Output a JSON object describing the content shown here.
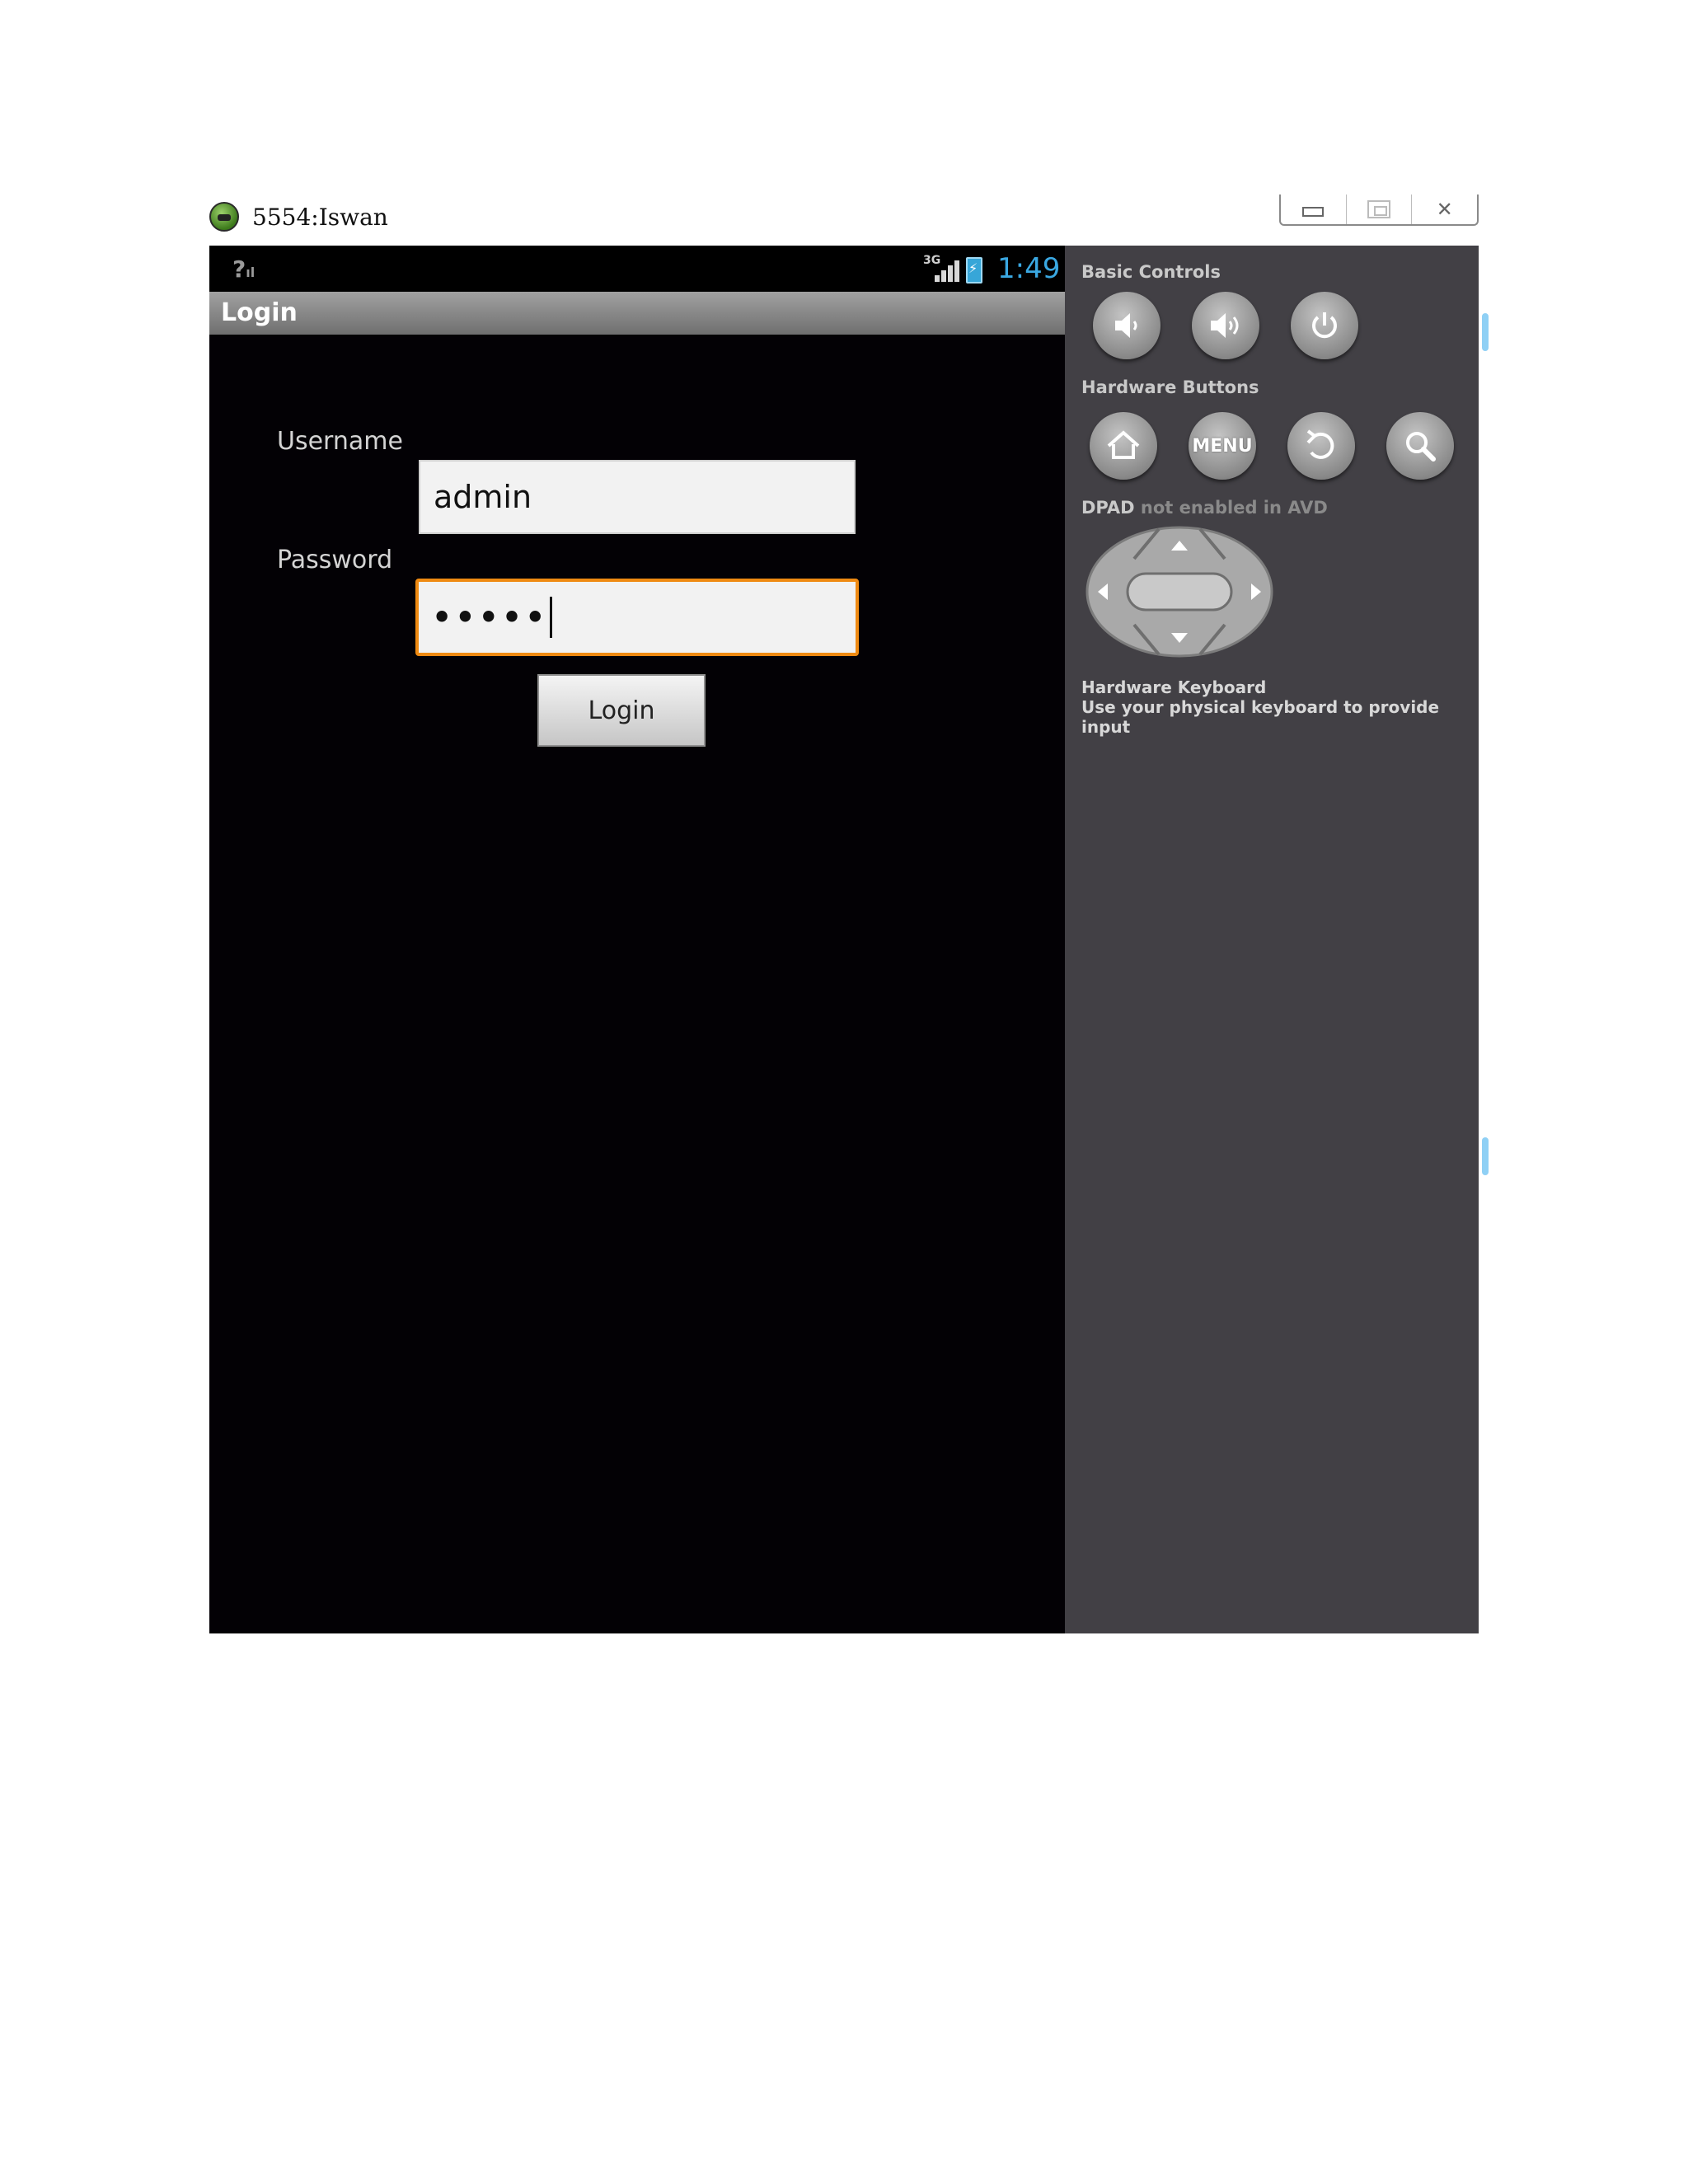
{
  "window": {
    "title": "5554:Iswan",
    "controls": {
      "minimize": "minimize",
      "maximize": "maximize",
      "close": "close"
    }
  },
  "statusbar": {
    "unknown_signal": "?",
    "network": "3G",
    "time": "1:49"
  },
  "actionbar": {
    "title": "Login"
  },
  "form": {
    "username_label": "Username",
    "username_value": "admin",
    "password_label": "Password",
    "password_masked": "•••••",
    "login_button": "Login"
  },
  "panel": {
    "basic_controls_title": "Basic Controls",
    "basic_controls": [
      {
        "icon": "volume-down-icon"
      },
      {
        "icon": "volume-up-icon"
      },
      {
        "icon": "power-icon"
      }
    ],
    "hardware_buttons_title": "Hardware Buttons",
    "hardware_buttons": [
      {
        "icon": "home-icon"
      },
      {
        "icon": "menu",
        "label": "MENU"
      },
      {
        "icon": "back-icon"
      },
      {
        "icon": "search-icon"
      }
    ],
    "dpad_title_bold": "DPAD",
    "dpad_title_rest": " not enabled in AVD",
    "keyboard_title": "Hardware Keyboard",
    "keyboard_subtitle": "Use your physical keyboard to provide input"
  },
  "colors": {
    "screen_bg": "#030105",
    "panel_bg": "#424045",
    "focus_border": "#ef8a12",
    "clock": "#3aa8e2"
  }
}
